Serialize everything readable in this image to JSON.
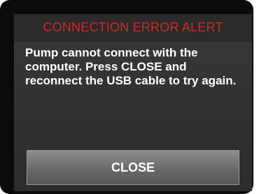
{
  "dialog": {
    "title": "CONNECTION ERROR ALERT",
    "message": "Pump cannot connect with the computer. Press CLOSE and reconnect the USB cable to try again.",
    "close_label": "CLOSE"
  },
  "colors": {
    "title_red": "#d42a25",
    "background": "#333333",
    "bezel": "#0b0b0b",
    "button": "#757575"
  }
}
